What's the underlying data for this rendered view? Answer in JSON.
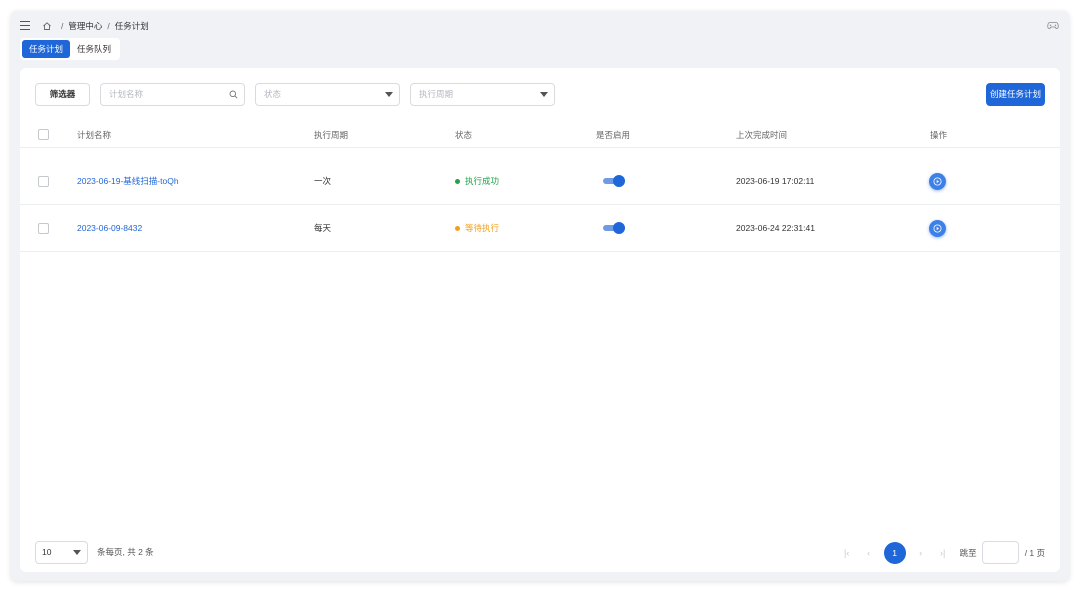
{
  "header": {
    "breadcrumb": [
      "管理中心",
      "任务计划"
    ],
    "separator": "/"
  },
  "tabs": [
    {
      "label": "任务计划",
      "active": true
    },
    {
      "label": "任务队列",
      "active": false
    }
  ],
  "toolbar": {
    "filter_label": "筛选器",
    "search_placeholder": "计划名称",
    "status_placeholder": "状态",
    "period_placeholder": "执行周期",
    "create_label": "创建任务计划"
  },
  "table": {
    "columns": [
      "计划名称",
      "执行周期",
      "状态",
      "是否启用",
      "上次完成时间",
      "操作"
    ],
    "rows": [
      {
        "name": "2023-06-19-基线扫描-toQh",
        "period": "一次",
        "status": "执行成功",
        "status_color": "#21a34a",
        "enabled": true,
        "last_finished": "2023-06-19 17:02:11"
      },
      {
        "name": "2023-06-09-8432",
        "period": "每天",
        "status": "等待执行",
        "status_color": "#f0a020",
        "enabled": true,
        "last_finished": "2023-06-24 22:31:41"
      }
    ]
  },
  "pagination": {
    "page_size": "10",
    "summary": "条每页, 共 2 条",
    "current_page": "1",
    "jump_label": "跳至",
    "total_pages": "/ 1 页"
  },
  "colors": {
    "accent": "#1f66d8",
    "success": "#21a34a",
    "warning": "#f0a020"
  }
}
